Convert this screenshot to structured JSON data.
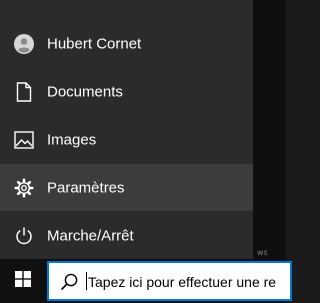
{
  "start_menu": {
    "items": [
      {
        "label": "Hubert Cornet",
        "icon": "user-account-icon"
      },
      {
        "label": "Documents",
        "icon": "document-icon"
      },
      {
        "label": "Images",
        "icon": "image-icon"
      },
      {
        "label": "Paramètres",
        "icon": "gear-icon",
        "active": true
      },
      {
        "label": "Marche/Arrêt",
        "icon": "power-icon"
      }
    ]
  },
  "taskbar": {
    "start_icon": "windows-logo-icon",
    "search": {
      "icon": "search-icon",
      "placeholder": "Tapez ici pour effectuer une re"
    }
  },
  "desktop": {
    "stray_text": "ws"
  },
  "colors": {
    "menu_bg": "#2b2b2b",
    "active_item_bg": "#3c3c3c",
    "taskbar_bg": "#101010",
    "search_border": "#0078d7"
  }
}
